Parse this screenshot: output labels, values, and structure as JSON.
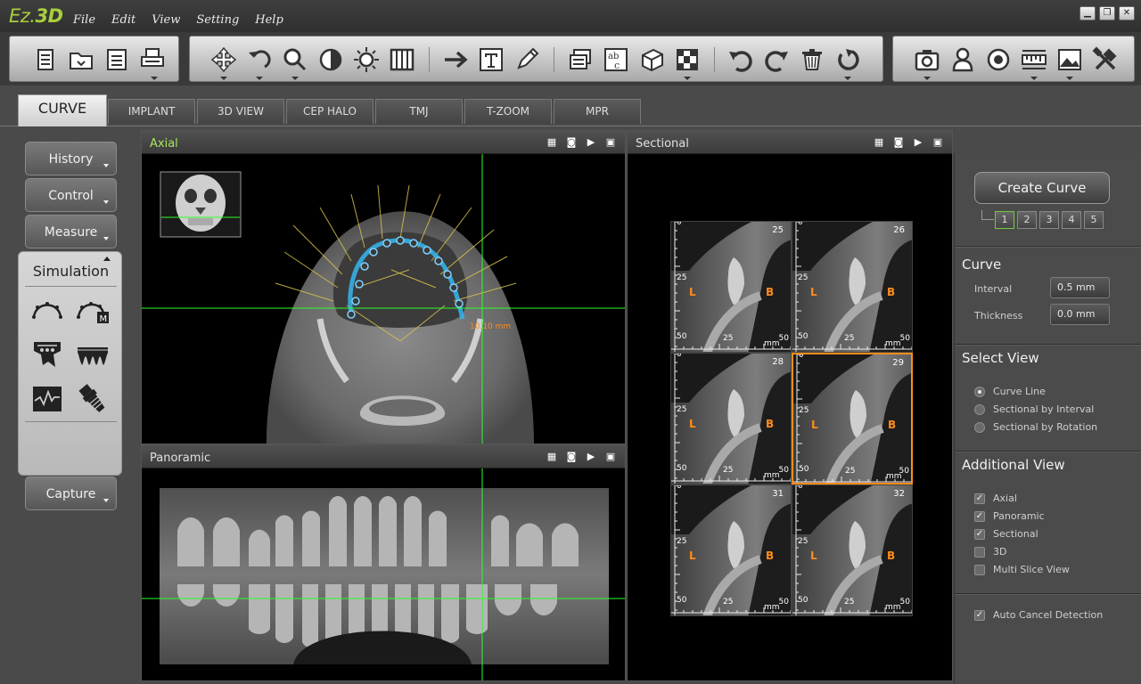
{
  "app": {
    "logo_ez": "Ez",
    "logo_3d": "3D"
  },
  "menu": [
    "File",
    "Edit",
    "View",
    "Setting",
    "Help"
  ],
  "window_buttons": {
    "minimize": "▁",
    "restore": "❐",
    "close": "✕"
  },
  "toolbar_groups": [
    [
      "new-document-icon",
      "open-folder-icon",
      "save-icon",
      "print-icon"
    ],
    [
      "move-icon",
      "rotate-icon",
      "zoom-icon",
      "contrast-icon",
      "brightness-icon",
      "columns-icon",
      "arrow-icon",
      "text-icon",
      "pen-icon",
      "layer-icon",
      "abc-icon",
      "cube-icon",
      "checker-icon",
      "undo-icon",
      "redo-icon",
      "trash-icon",
      "reset-icon"
    ],
    [
      "camera-icon",
      "person-icon",
      "target-icon",
      "ruler-icon",
      "image-icon",
      "tools-icon"
    ]
  ],
  "tabs": [
    "CURVE",
    "IMPLANT",
    "3D VIEW",
    "CEP HALO",
    "TMJ",
    "T-ZOOM",
    "MPR"
  ],
  "active_tab": "CURVE",
  "side_buttons": {
    "history": "History",
    "control": "Control",
    "measure": "Measure",
    "capture": "Capture"
  },
  "simulation": {
    "title": "Simulation",
    "icons": [
      "arch-icon",
      "arch-manual-icon",
      "tooth-crown-icon",
      "teeth-row-icon",
      "nerve-icon",
      "implant-tool-icon"
    ]
  },
  "views": {
    "axial": {
      "title": "Axial",
      "measurement": "10.10 mm"
    },
    "panoramic": {
      "title": "Panoramic"
    },
    "sectional": {
      "title": "Sectional",
      "tiles": [
        {
          "number": "25",
          "selected": false
        },
        {
          "number": "26",
          "selected": false
        },
        {
          "number": "28",
          "selected": false
        },
        {
          "number": "29",
          "selected": true
        },
        {
          "number": "31",
          "selected": false
        },
        {
          "number": "32",
          "selected": false
        }
      ],
      "marker_l": "L",
      "marker_b": "B",
      "ticks": {
        "top": "0",
        "mid": "25",
        "bottom": "50",
        "x_mid": "25",
        "x_end": "50",
        "unit": "mm"
      }
    }
  },
  "right_panel": {
    "create_curve": "Create Curve",
    "curve_numbers": [
      "1",
      "2",
      "3",
      "4",
      "5"
    ],
    "selected_curve": "1",
    "curve": {
      "title": "Curve",
      "interval_label": "Interval",
      "interval_value": "0.5 mm",
      "thickness_label": "Thickness",
      "thickness_value": "0.0 mm"
    },
    "select_view": {
      "title": "Select View",
      "options": [
        {
          "label": "Curve Line",
          "checked": true
        },
        {
          "label": "Sectional by Interval",
          "checked": false
        },
        {
          "label": "Sectional by Rotation",
          "checked": false
        }
      ]
    },
    "additional_view": {
      "title": "Additional View",
      "options": [
        {
          "label": "Axial",
          "checked": true
        },
        {
          "label": "Panoramic",
          "checked": true
        },
        {
          "label": "Sectional",
          "checked": true
        },
        {
          "label": "3D",
          "checked": false
        },
        {
          "label": "Multi Slice View",
          "checked": false
        }
      ]
    },
    "auto_cancel": {
      "label": "Auto Cancel Detection",
      "checked": true
    }
  },
  "colors": {
    "accent_green": "#a8cf3c",
    "crosshair": "#2cff2c",
    "curve_blue": "#36b7f0",
    "selected_orange": "#ff8c1a"
  }
}
